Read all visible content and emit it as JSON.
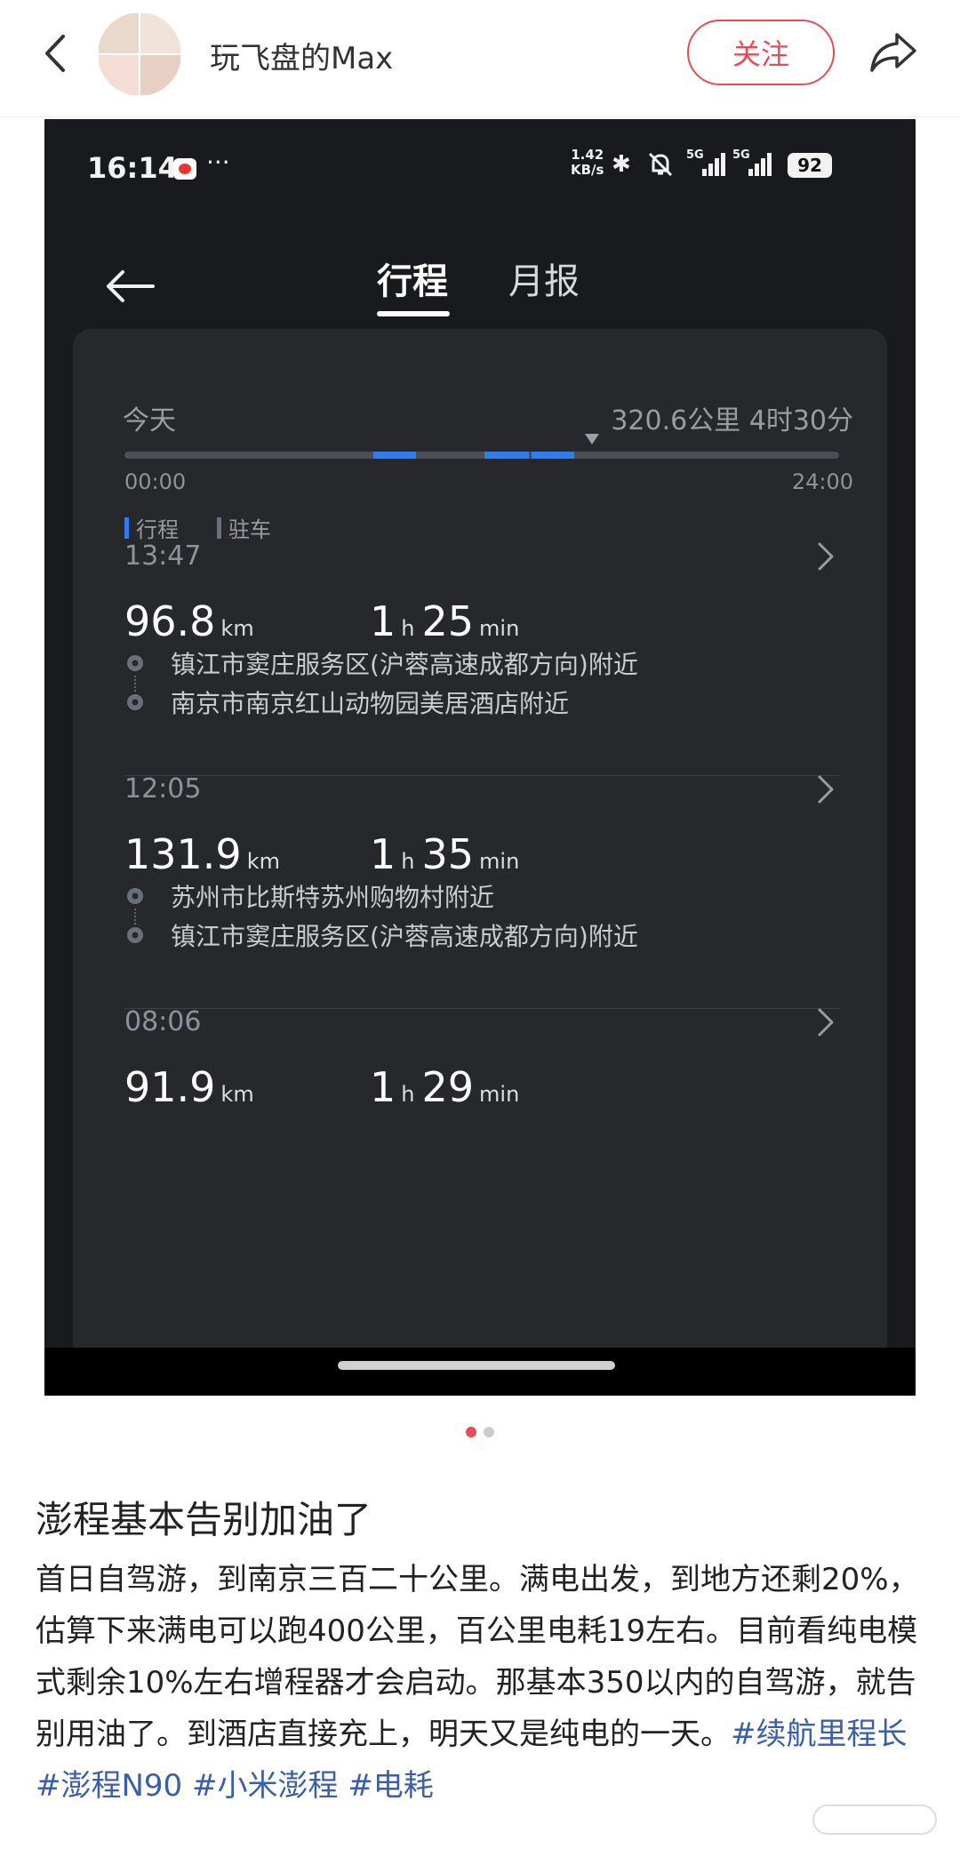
{
  "header": {
    "username": "玩飞盘的Max",
    "follow_label": "关注"
  },
  "screenshot": {
    "status": {
      "time": "16:14",
      "more": "···",
      "net_speed_value": "1.42",
      "net_speed_unit": "KB/s",
      "signal_1": "5G",
      "signal_2": "5G",
      "battery": "92"
    },
    "tabs": [
      {
        "label": "行程",
        "active": true
      },
      {
        "label": "月报",
        "active": false
      }
    ],
    "day": {
      "label": "今天",
      "summary": "320.6公里 4时30分",
      "timeline_start": "00:00",
      "timeline_end": "24:00",
      "legend_trip": "行程",
      "legend_park": "驻车",
      "trip_color": "#2f7bf0",
      "park_color": "#4b4e55"
    },
    "trips": [
      {
        "time": "13:47",
        "distance": "96.8",
        "distance_unit": "km",
        "hours": "1",
        "hours_unit": "h",
        "minutes": "25",
        "minutes_unit": "min",
        "from": "镇江市窦庄服务区(沪蓉高速成都方向)附近",
        "to": "南京市南京红山动物园美居酒店附近"
      },
      {
        "time": "12:05",
        "distance": "131.9",
        "distance_unit": "km",
        "hours": "1",
        "hours_unit": "h",
        "minutes": "35",
        "minutes_unit": "min",
        "from": "苏州市比斯特苏州购物村附近",
        "to": "镇江市窦庄服务区(沪蓉高速成都方向)附近"
      },
      {
        "time": "08:06",
        "distance": "91.9",
        "distance_unit": "km",
        "hours": "1",
        "hours_unit": "h",
        "minutes": "29",
        "minutes_unit": "min"
      }
    ]
  },
  "post": {
    "title": "澎程基本告别加油了",
    "body": "首日自驾游，到南京三百二十公里。满电出发，到地方还剩20%，估算下来满电可以跑400公里，百公里电耗19左右。目前看纯电模式剩余10%左右增程器才会启动。那基本350以内的自驾游，就告别用油了。到酒店直接充上，明天又是纯电的一天。",
    "tags": [
      "#续航里程长",
      "#澎程N90",
      "#小米澎程",
      "#电耗"
    ]
  },
  "pager": {
    "count": 2,
    "active_index": 0
  },
  "colors": {
    "accent": "#e84a57",
    "tag": "#3a5ea8"
  }
}
